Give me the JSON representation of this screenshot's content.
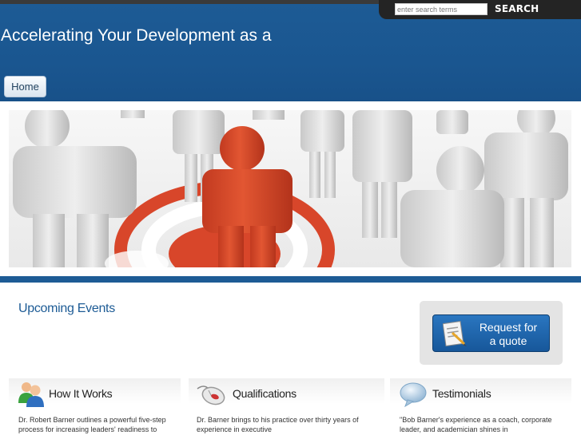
{
  "search": {
    "placeholder": "enter search terms",
    "button_label": "SEARCH"
  },
  "header": {
    "title": "Accelerating Your Development as a"
  },
  "nav": {
    "items": [
      {
        "label": "Home"
      }
    ]
  },
  "events": {
    "title": "Upcoming Events"
  },
  "quote": {
    "label": "Request for a quote"
  },
  "columns": [
    {
      "title": "How It Works",
      "text": "Dr. Robert Barner outlines a powerful five-step process for increasing leaders' readiness to"
    },
    {
      "title": "Qualifications",
      "text": "Dr. Barner brings to his practice over thirty years of experience in executive"
    },
    {
      "title": "Testimonials",
      "text": "\"Bob Barner's experience as a coach, corporate leader, and academician shines in"
    }
  ],
  "colors": {
    "header_blue": "#1d5b95",
    "accent_red": "#d8462a"
  }
}
